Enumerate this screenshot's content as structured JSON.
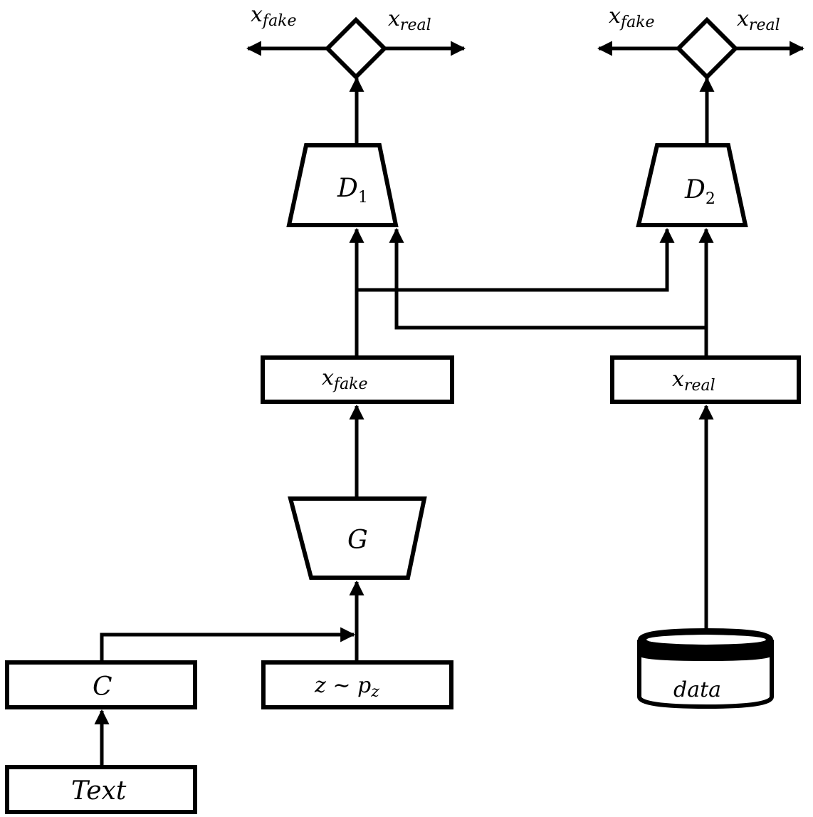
{
  "diagram": {
    "discriminator1": {
      "label": "D",
      "subscript": "1",
      "out_left": {
        "base": "x",
        "sub": "fake"
      },
      "out_right": {
        "base": "x",
        "sub": "real"
      }
    },
    "discriminator2": {
      "label": "D",
      "subscript": "2",
      "out_left": {
        "base": "x",
        "sub": "fake"
      },
      "out_right": {
        "base": "x",
        "sub": "real"
      }
    },
    "generator": {
      "label": "G"
    },
    "x_fake_box": {
      "base": "x",
      "sub": "fake"
    },
    "x_real_box": {
      "base": "x",
      "sub": "real"
    },
    "condition_box": {
      "label": "C"
    },
    "noise_box": {
      "label": "z ∼ p",
      "sub": "z"
    },
    "text_box": {
      "label": "Text"
    },
    "data_store": {
      "label": "data"
    }
  }
}
